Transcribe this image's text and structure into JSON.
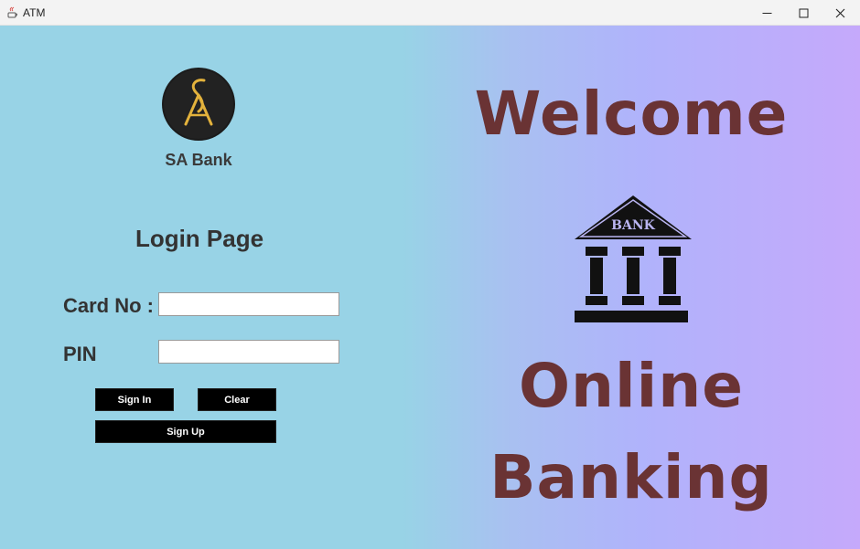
{
  "window": {
    "title": "ATM",
    "controls": [
      "minimize",
      "maximize",
      "close"
    ]
  },
  "brand": {
    "logo_text": "SA",
    "logo_colors": {
      "background": "#1b1b1b",
      "accent": "#e3b23c"
    },
    "name": "SA Bank"
  },
  "login": {
    "title": "Login Page",
    "card_label": "Card No :",
    "card_value": "",
    "pin_label": "PIN",
    "pin_value": ""
  },
  "buttons": {
    "sign_in": "Sign In",
    "clear": "Clear",
    "sign_up": "Sign Up"
  },
  "hero": {
    "welcome": "Welcome",
    "bank_sign": "BANK",
    "line1": "Online",
    "line2": "Banking"
  },
  "colors": {
    "left_bg": "#98d3e6",
    "right_bg": "#c5a9fb",
    "hero_text": "#6a3334",
    "button_bg": "#000000"
  },
  "icons": [
    "java-app-icon",
    "minimize-icon",
    "maximize-icon",
    "close-icon",
    "bank-building-icon"
  ]
}
